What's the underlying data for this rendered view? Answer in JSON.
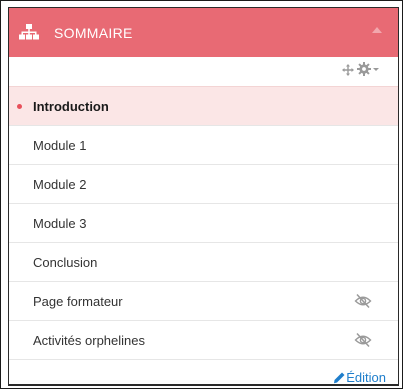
{
  "block": {
    "title": "SOMMAIRE",
    "header_color": "#e86a74",
    "title_icon": "sitemap-icon"
  },
  "controls": {
    "move_icon": "move-icon",
    "settings_icon": "gear-icon"
  },
  "items": [
    {
      "label": "Introduction",
      "active": true
    },
    {
      "label": "Module 1"
    },
    {
      "label": "Module 2"
    },
    {
      "label": "Module 3"
    },
    {
      "label": "Conclusion"
    },
    {
      "label": "Page formateur",
      "hidden_icon": "eye-off-icon"
    },
    {
      "label": "Activités orphelines",
      "hidden_icon": "eye-off-icon"
    }
  ],
  "footer": {
    "edit_label": "Édition",
    "edit_color": "#1f7ecb"
  },
  "colors": {
    "active_background": "#fbe6e6",
    "active_dot": "#e8505b"
  }
}
